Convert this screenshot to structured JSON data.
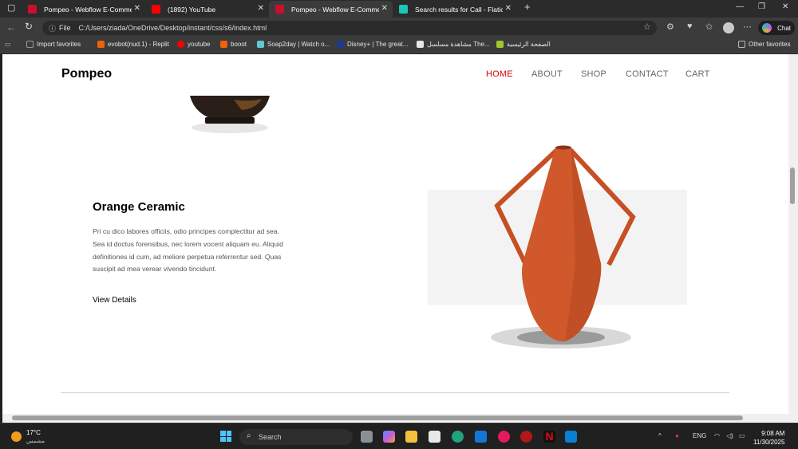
{
  "browser": {
    "tabs": [
      {
        "title": "Pompeo - Webflow E-Commerce",
        "active": false,
        "favicon_color": "#c8102e"
      },
      {
        "title": "(1892) YouTube",
        "active": false,
        "favicon_color": "#ff0000"
      },
      {
        "title": "Pompeo - Webflow E-Commerce",
        "active": true,
        "favicon_color": "#c8102e"
      },
      {
        "title": "Search results for Call - Flaticon",
        "active": false,
        "favicon_color": "#1bc5b7"
      }
    ],
    "address": {
      "scheme_label": "File",
      "url": "C:/Users/ziada/OneDrive/Desktop/instant/css/s6/index.html"
    },
    "chat_label": "Chat",
    "bookmarks": [
      {
        "label": "Import favorites",
        "icon_color": "#9a9a9a"
      },
      {
        "label": "evobot(nud.1) - Replit",
        "icon_color": "#f26207"
      },
      {
        "label": "youtube",
        "icon_color": "#ff0000"
      },
      {
        "label": "booot",
        "icon_color": "#f26207"
      },
      {
        "label": "Soap2day | Watch o...",
        "icon_color": "#5ec9d6"
      },
      {
        "label": "Disney+ | The great...",
        "icon_color": "#1e3a8a"
      },
      {
        "label": "مشاهدة مسلسل The...",
        "icon_color": "#e7e7e7"
      },
      {
        "label": "الصفحة الرئيسية",
        "icon_color": "#a3c52f"
      }
    ],
    "other_favorites": "Other favorites"
  },
  "site": {
    "brand": "Pompeo",
    "nav": [
      {
        "label": "HOME",
        "active": true
      },
      {
        "label": "ABOUT",
        "active": false
      },
      {
        "label": "SHOP",
        "active": false
      },
      {
        "label": "CONTACT",
        "active": false
      },
      {
        "label": "CART",
        "active": false
      }
    ],
    "product": {
      "title": "Orange Ceramic",
      "description": "Pri cu dico labores officiis, odio principes complectitur ad sea. Sea id doctus forensibus, nec lorem vocent aliquam eu. Aliquid definitiones id cum, ad meliore perpetua referrentur sed. Quas suscipit ad mea verear vivendo tincidunt.",
      "link": "View Details"
    },
    "accent_color": "#d90000",
    "vase_color": "#d0582b"
  },
  "taskbar": {
    "weather": {
      "temp": "17°C",
      "condition": "مشمس"
    },
    "search_placeholder": "Search",
    "language": "ENG",
    "time": "9:08 AM",
    "date": "11/30/2025"
  }
}
